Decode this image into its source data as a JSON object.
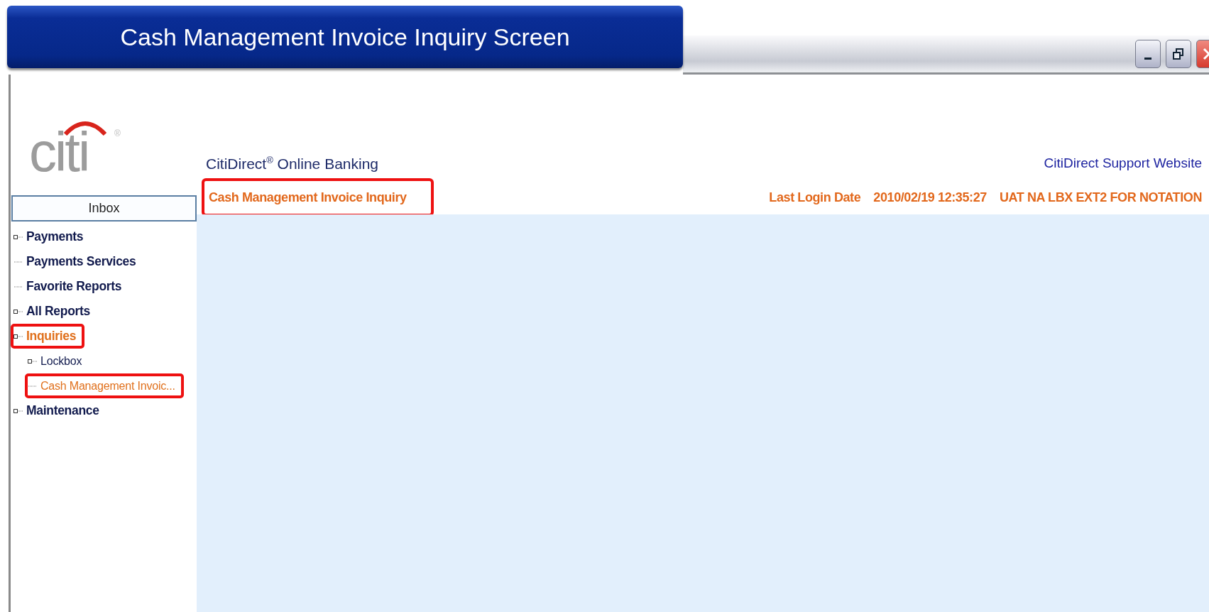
{
  "banner": {
    "title": "Cash Management Invoice Inquiry Screen"
  },
  "window_controls": [
    {
      "kind": "minimize"
    },
    {
      "kind": "restore"
    },
    {
      "kind": "close"
    }
  ],
  "logo": {
    "text": "citi",
    "mark": "®"
  },
  "sidebar": {
    "inbox": "Inbox",
    "items": [
      {
        "label": "Payments",
        "expandable": true,
        "selected": false,
        "highlighted": false
      },
      {
        "label": "Payments Services",
        "expandable": false,
        "selected": false,
        "highlighted": false
      },
      {
        "label": "Favorite Reports",
        "expandable": false,
        "selected": false,
        "highlighted": false
      },
      {
        "label": "All Reports",
        "expandable": true,
        "selected": false,
        "highlighted": false
      },
      {
        "label": "Inquiries",
        "expandable": true,
        "selected": true,
        "highlighted": true,
        "children": [
          {
            "label": "Lockbox",
            "expandable": true,
            "selected": false,
            "highlighted": false
          },
          {
            "label": "Cash Management Invoic...",
            "expandable": false,
            "selected": true,
            "highlighted": true
          }
        ]
      },
      {
        "label": "Maintenance",
        "expandable": true,
        "selected": false,
        "highlighted": false
      }
    ]
  },
  "header": {
    "brand": "CitiDirect",
    "brand_mark": "®",
    "brand_rest": " Online Banking",
    "support_link": "CitiDirect Support Website",
    "page_title": {
      "text": "Cash Management Invoice Inquiry",
      "highlighted": true
    },
    "last_login_label": "Last Login Date",
    "last_login_value": "2010/02/19 12:35:27",
    "user": "UAT NA LBX EXT2 FOR NOTATION"
  }
}
